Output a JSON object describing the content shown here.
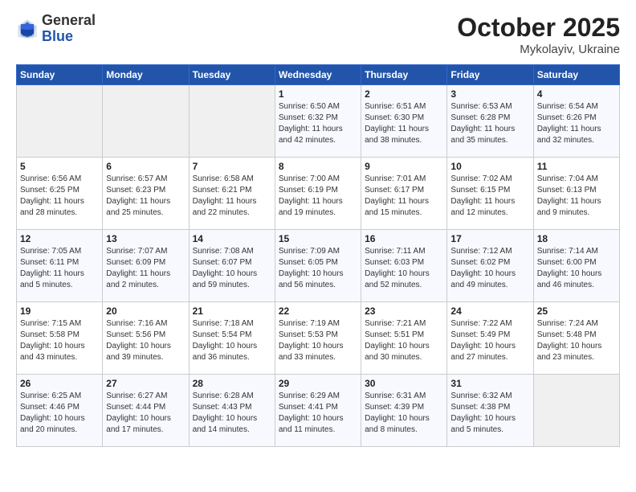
{
  "header": {
    "logo": {
      "general": "General",
      "blue": "Blue"
    },
    "month": "October 2025",
    "location": "Mykolayiv, Ukraine"
  },
  "weekdays": [
    "Sunday",
    "Monday",
    "Tuesday",
    "Wednesday",
    "Thursday",
    "Friday",
    "Saturday"
  ],
  "weeks": [
    [
      {
        "day": "",
        "sunrise": "",
        "sunset": "",
        "daylight": ""
      },
      {
        "day": "",
        "sunrise": "",
        "sunset": "",
        "daylight": ""
      },
      {
        "day": "",
        "sunrise": "",
        "sunset": "",
        "daylight": ""
      },
      {
        "day": "1",
        "sunrise": "Sunrise: 6:50 AM",
        "sunset": "Sunset: 6:32 PM",
        "daylight": "Daylight: 11 hours and 42 minutes."
      },
      {
        "day": "2",
        "sunrise": "Sunrise: 6:51 AM",
        "sunset": "Sunset: 6:30 PM",
        "daylight": "Daylight: 11 hours and 38 minutes."
      },
      {
        "day": "3",
        "sunrise": "Sunrise: 6:53 AM",
        "sunset": "Sunset: 6:28 PM",
        "daylight": "Daylight: 11 hours and 35 minutes."
      },
      {
        "day": "4",
        "sunrise": "Sunrise: 6:54 AM",
        "sunset": "Sunset: 6:26 PM",
        "daylight": "Daylight: 11 hours and 32 minutes."
      }
    ],
    [
      {
        "day": "5",
        "sunrise": "Sunrise: 6:56 AM",
        "sunset": "Sunset: 6:25 PM",
        "daylight": "Daylight: 11 hours and 28 minutes."
      },
      {
        "day": "6",
        "sunrise": "Sunrise: 6:57 AM",
        "sunset": "Sunset: 6:23 PM",
        "daylight": "Daylight: 11 hours and 25 minutes."
      },
      {
        "day": "7",
        "sunrise": "Sunrise: 6:58 AM",
        "sunset": "Sunset: 6:21 PM",
        "daylight": "Daylight: 11 hours and 22 minutes."
      },
      {
        "day": "8",
        "sunrise": "Sunrise: 7:00 AM",
        "sunset": "Sunset: 6:19 PM",
        "daylight": "Daylight: 11 hours and 19 minutes."
      },
      {
        "day": "9",
        "sunrise": "Sunrise: 7:01 AM",
        "sunset": "Sunset: 6:17 PM",
        "daylight": "Daylight: 11 hours and 15 minutes."
      },
      {
        "day": "10",
        "sunrise": "Sunrise: 7:02 AM",
        "sunset": "Sunset: 6:15 PM",
        "daylight": "Daylight: 11 hours and 12 minutes."
      },
      {
        "day": "11",
        "sunrise": "Sunrise: 7:04 AM",
        "sunset": "Sunset: 6:13 PM",
        "daylight": "Daylight: 11 hours and 9 minutes."
      }
    ],
    [
      {
        "day": "12",
        "sunrise": "Sunrise: 7:05 AM",
        "sunset": "Sunset: 6:11 PM",
        "daylight": "Daylight: 11 hours and 5 minutes."
      },
      {
        "day": "13",
        "sunrise": "Sunrise: 7:07 AM",
        "sunset": "Sunset: 6:09 PM",
        "daylight": "Daylight: 11 hours and 2 minutes."
      },
      {
        "day": "14",
        "sunrise": "Sunrise: 7:08 AM",
        "sunset": "Sunset: 6:07 PM",
        "daylight": "Daylight: 10 hours and 59 minutes."
      },
      {
        "day": "15",
        "sunrise": "Sunrise: 7:09 AM",
        "sunset": "Sunset: 6:05 PM",
        "daylight": "Daylight: 10 hours and 56 minutes."
      },
      {
        "day": "16",
        "sunrise": "Sunrise: 7:11 AM",
        "sunset": "Sunset: 6:03 PM",
        "daylight": "Daylight: 10 hours and 52 minutes."
      },
      {
        "day": "17",
        "sunrise": "Sunrise: 7:12 AM",
        "sunset": "Sunset: 6:02 PM",
        "daylight": "Daylight: 10 hours and 49 minutes."
      },
      {
        "day": "18",
        "sunrise": "Sunrise: 7:14 AM",
        "sunset": "Sunset: 6:00 PM",
        "daylight": "Daylight: 10 hours and 46 minutes."
      }
    ],
    [
      {
        "day": "19",
        "sunrise": "Sunrise: 7:15 AM",
        "sunset": "Sunset: 5:58 PM",
        "daylight": "Daylight: 10 hours and 43 minutes."
      },
      {
        "day": "20",
        "sunrise": "Sunrise: 7:16 AM",
        "sunset": "Sunset: 5:56 PM",
        "daylight": "Daylight: 10 hours and 39 minutes."
      },
      {
        "day": "21",
        "sunrise": "Sunrise: 7:18 AM",
        "sunset": "Sunset: 5:54 PM",
        "daylight": "Daylight: 10 hours and 36 minutes."
      },
      {
        "day": "22",
        "sunrise": "Sunrise: 7:19 AM",
        "sunset": "Sunset: 5:53 PM",
        "daylight": "Daylight: 10 hours and 33 minutes."
      },
      {
        "day": "23",
        "sunrise": "Sunrise: 7:21 AM",
        "sunset": "Sunset: 5:51 PM",
        "daylight": "Daylight: 10 hours and 30 minutes."
      },
      {
        "day": "24",
        "sunrise": "Sunrise: 7:22 AM",
        "sunset": "Sunset: 5:49 PM",
        "daylight": "Daylight: 10 hours and 27 minutes."
      },
      {
        "day": "25",
        "sunrise": "Sunrise: 7:24 AM",
        "sunset": "Sunset: 5:48 PM",
        "daylight": "Daylight: 10 hours and 23 minutes."
      }
    ],
    [
      {
        "day": "26",
        "sunrise": "Sunrise: 6:25 AM",
        "sunset": "Sunset: 4:46 PM",
        "daylight": "Daylight: 10 hours and 20 minutes."
      },
      {
        "day": "27",
        "sunrise": "Sunrise: 6:27 AM",
        "sunset": "Sunset: 4:44 PM",
        "daylight": "Daylight: 10 hours and 17 minutes."
      },
      {
        "day": "28",
        "sunrise": "Sunrise: 6:28 AM",
        "sunset": "Sunset: 4:43 PM",
        "daylight": "Daylight: 10 hours and 14 minutes."
      },
      {
        "day": "29",
        "sunrise": "Sunrise: 6:29 AM",
        "sunset": "Sunset: 4:41 PM",
        "daylight": "Daylight: 10 hours and 11 minutes."
      },
      {
        "day": "30",
        "sunrise": "Sunrise: 6:31 AM",
        "sunset": "Sunset: 4:39 PM",
        "daylight": "Daylight: 10 hours and 8 minutes."
      },
      {
        "day": "31",
        "sunrise": "Sunrise: 6:32 AM",
        "sunset": "Sunset: 4:38 PM",
        "daylight": "Daylight: 10 hours and 5 minutes."
      },
      {
        "day": "",
        "sunrise": "",
        "sunset": "",
        "daylight": ""
      }
    ]
  ]
}
